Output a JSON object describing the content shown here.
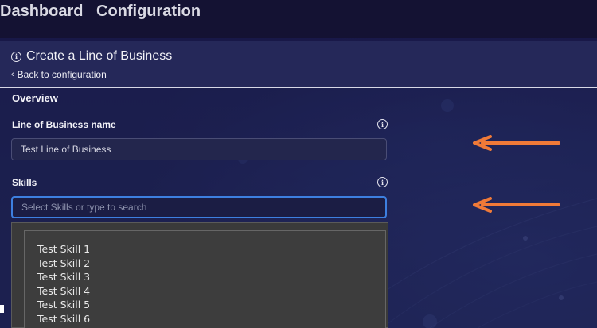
{
  "nav": {
    "items": [
      "Dashboard",
      "Configuration"
    ]
  },
  "page": {
    "title": "Create a Line of Business",
    "back_link": "Back to configuration",
    "section_heading": "Overview"
  },
  "form": {
    "lob_label": "Line of Business name",
    "lob_value": "Test Line of Business",
    "skills_label": "Skills",
    "skills_placeholder": "Select Skills or type to search"
  },
  "dropdown": {
    "options": [
      "Test Skill 1",
      "Test Skill 2",
      "Test Skill 3",
      "Test Skill 4",
      "Test Skill 5",
      "Test Skill 6"
    ]
  },
  "icons": {
    "info": "info-icon",
    "back": "chevron-left-icon",
    "annotation": "arrow-left-icon"
  },
  "colors": {
    "annotation_arrow": "#f07a38",
    "focus_border": "#3d7fe0",
    "background": "#14133a"
  }
}
